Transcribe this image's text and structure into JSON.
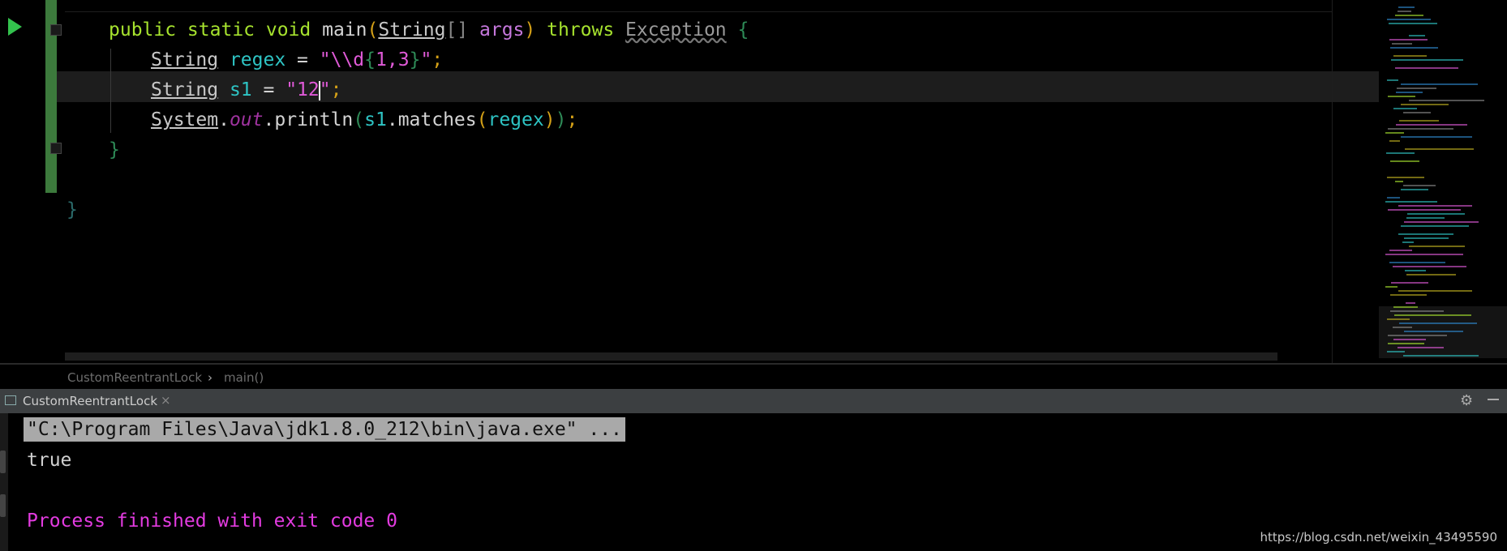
{
  "editor": {
    "lines": [
      {
        "kw1": "public static void ",
        "name": "main",
        "lp": "(",
        "type": "String",
        "arr": "[] ",
        "param": "args",
        "rp": ") ",
        "throws": "throws ",
        "exc": "Exception",
        "brace": " {"
      },
      {
        "type": "String",
        "var": " regex",
        "eq": " = ",
        "q1": "\"",
        "esc": "\\\\d",
        "b1": "{",
        "n1": "1",
        "comma": ",",
        "n2": "3",
        "b2": "}",
        "q2": "\"",
        "semi": ";"
      },
      {
        "type": "String",
        "var": " s1",
        "eq": " = ",
        "q1": "\"",
        "val1": "12",
        "q2": "\"",
        "semi": ";"
      },
      {
        "sys": "System",
        "dot": ".",
        "out": "out",
        "call": ".println",
        "lp": "(",
        "obj": "s1",
        "m": ".matches",
        "lp2": "(",
        "arg": "regex",
        "rp2": ")",
        "rp": ")",
        "semi": ";"
      },
      {
        "close": "}"
      },
      {
        "close": "}"
      }
    ]
  },
  "breadcrumb": {
    "class": "CustomReentrantLock",
    "sep": "›",
    "method": "main()"
  },
  "run_tab": {
    "label": "CustomReentrantLock",
    "close": "×"
  },
  "console": {
    "command": "\"C:\\Program Files\\Java\\jdk1.8.0_212\\bin\\java.exe\" ...",
    "output": "true",
    "finished": "Process finished with exit code 0"
  },
  "watermark": "https://blog.csdn.net/weixin_43495590",
  "colors": {
    "keyword": "#a6e22e",
    "string": "#e05ad8",
    "variable": "#2ec4c4",
    "change_bar": "#3c7a3c"
  },
  "icons": [
    "run-icon",
    "gear-icon",
    "minimize-icon",
    "close-icon",
    "console-icon"
  ]
}
